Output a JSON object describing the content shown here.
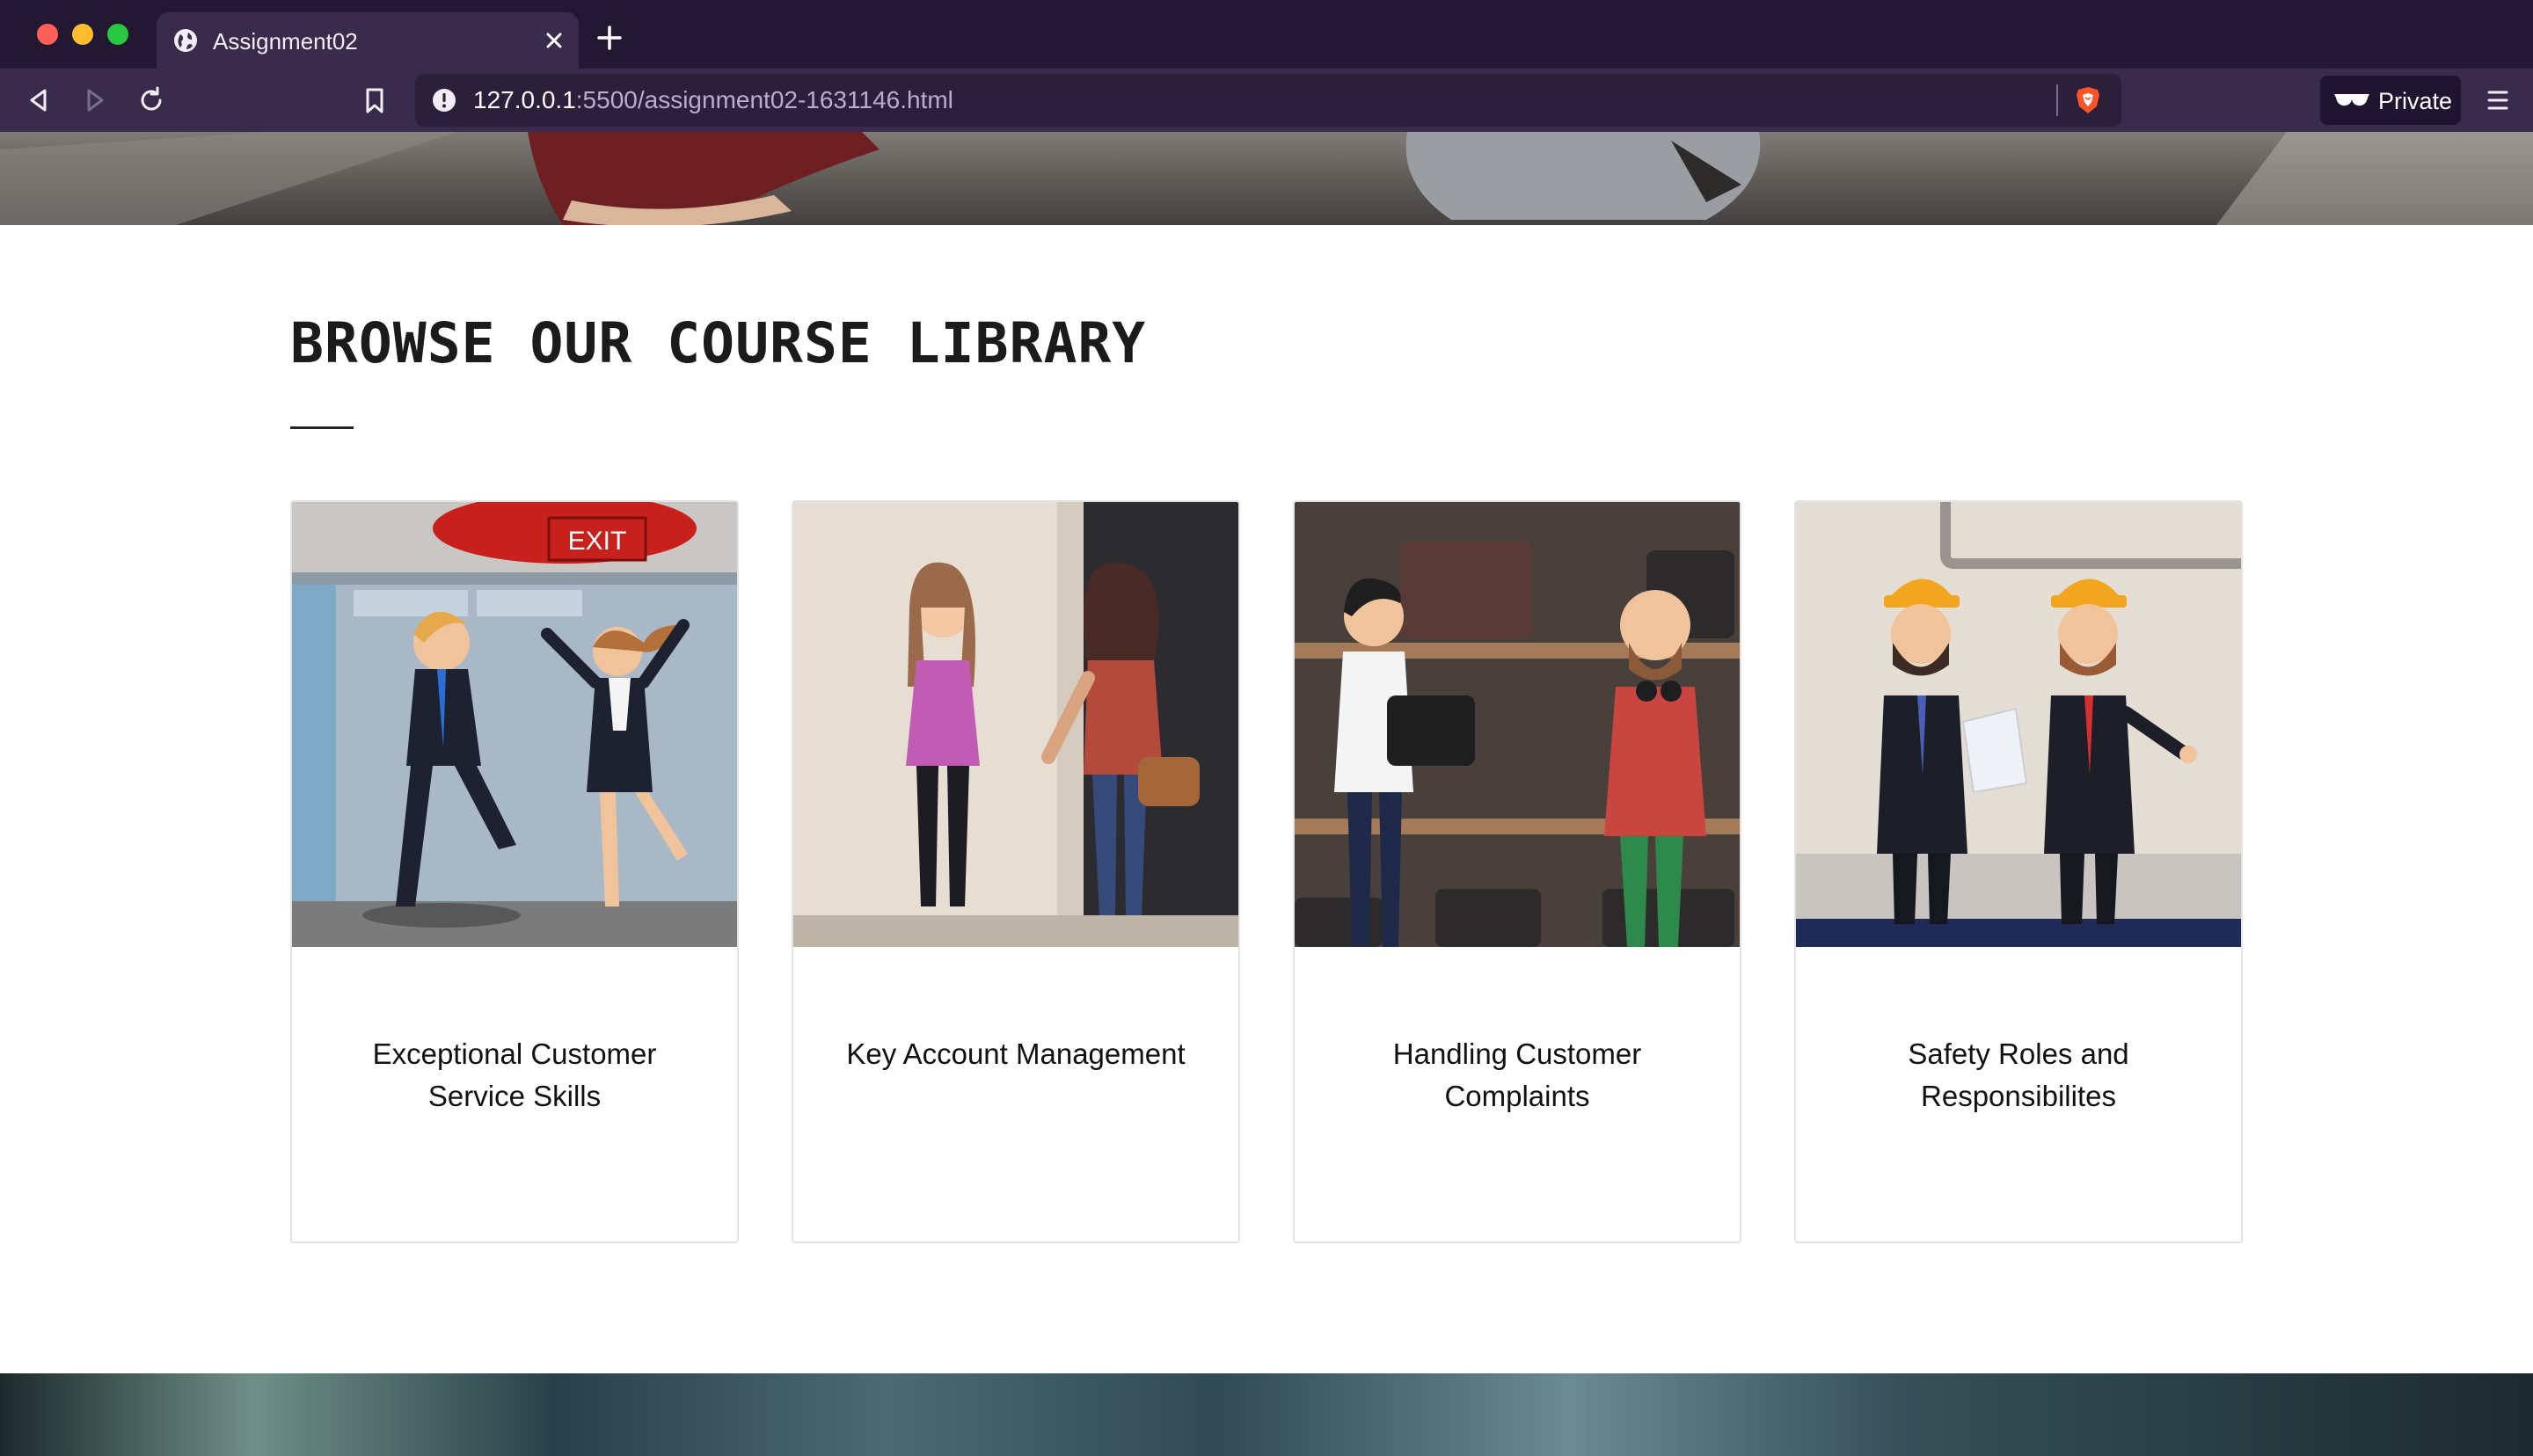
{
  "browser": {
    "tab_title": "Assignment02",
    "url_host": "127.0.0.1",
    "url_rest": ":5500/assignment02-1631146.html",
    "private_label": "Private"
  },
  "page": {
    "heading": "BROWSE OUR COURSE LIBRARY",
    "courses": [
      {
        "title": "Exceptional Customer Service Skills",
        "image_icon": "office-evacuation-illustration"
      },
      {
        "title": "Key Account Management",
        "image_icon": "two-women-conversation-illustration"
      },
      {
        "title": "Handling Customer Complaints",
        "image_icon": "bag-shop-customer-illustration"
      },
      {
        "title": "Safety Roles and Responsibilites",
        "image_icon": "construction-managers-illustration"
      }
    ]
  },
  "colors": {
    "chrome_bg": "#2c1e3c",
    "tab_bg": "#3a2a4c",
    "heading": "#1b1b1b"
  }
}
